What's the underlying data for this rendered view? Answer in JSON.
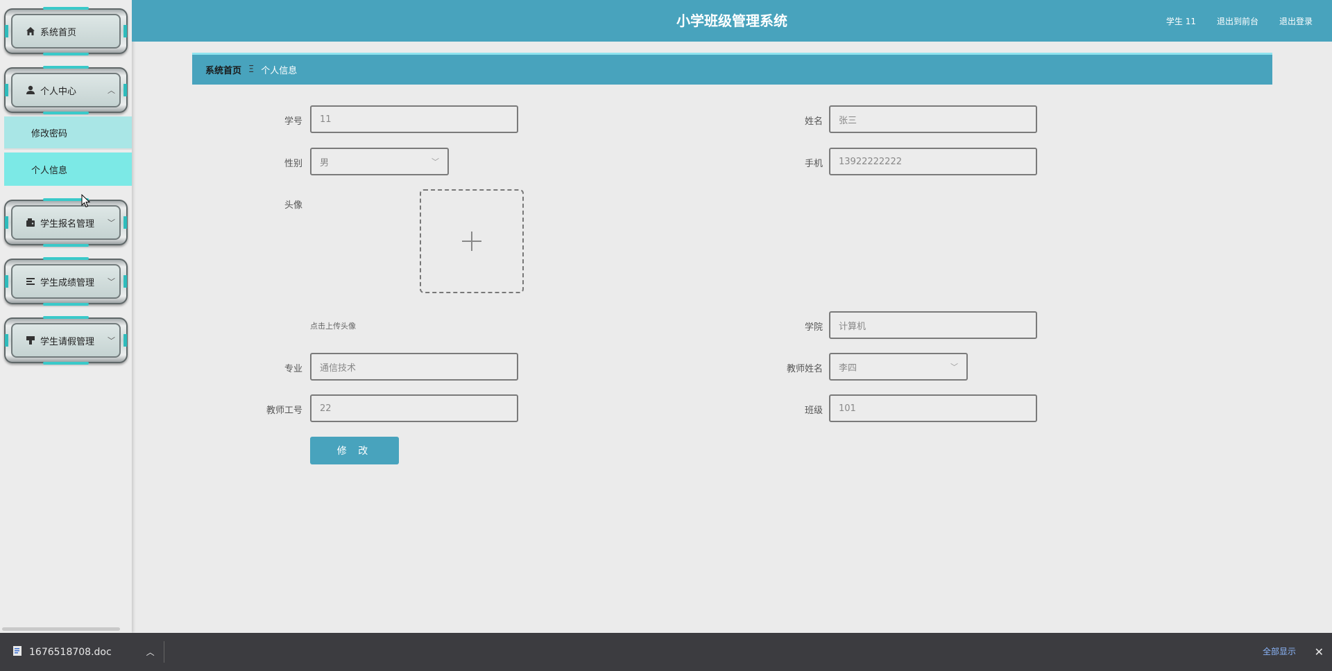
{
  "header": {
    "title": "小学班级管理系统",
    "user": "学生 11",
    "back_to_front": "退出到前台",
    "logout": "退出登录"
  },
  "sidebar": {
    "items": [
      {
        "label": "系统首页",
        "icon": "home-icon"
      },
      {
        "label": "个人中心",
        "icon": "user-icon",
        "expanded": true
      },
      {
        "label": "学生报名管理",
        "icon": "wallet-icon"
      },
      {
        "label": "学生成绩管理",
        "icon": "list-icon"
      },
      {
        "label": "学生请假管理",
        "icon": "stamp-icon"
      }
    ],
    "submenu": [
      {
        "label": "修改密码"
      },
      {
        "label": "个人信息",
        "active": true
      }
    ]
  },
  "breadcrumb": {
    "home": "系统首页",
    "separator": "Ξ",
    "current": "个人信息"
  },
  "form": {
    "student_no": {
      "label": "学号",
      "value": "11"
    },
    "name": {
      "label": "姓名",
      "value": "张三"
    },
    "gender": {
      "label": "性别",
      "value": "男"
    },
    "phone": {
      "label": "手机",
      "value": "13922222222"
    },
    "avatar": {
      "label": "头像",
      "hint": "点击上传头像"
    },
    "college": {
      "label": "学院",
      "value": "计算机"
    },
    "major": {
      "label": "专业",
      "value": "通信技术"
    },
    "teacher_name": {
      "label": "教师姓名",
      "value": "李四"
    },
    "teacher_no": {
      "label": "教师工号",
      "value": "22"
    },
    "class": {
      "label": "班级",
      "value": "101"
    },
    "submit": "修 改"
  },
  "download_bar": {
    "filename": "1676518708.doc",
    "show_all": "全部显示"
  },
  "colors": {
    "primary": "#48a3bd",
    "submenu_active": "#7ce9e6",
    "submenu": "#a9e6e6"
  }
}
